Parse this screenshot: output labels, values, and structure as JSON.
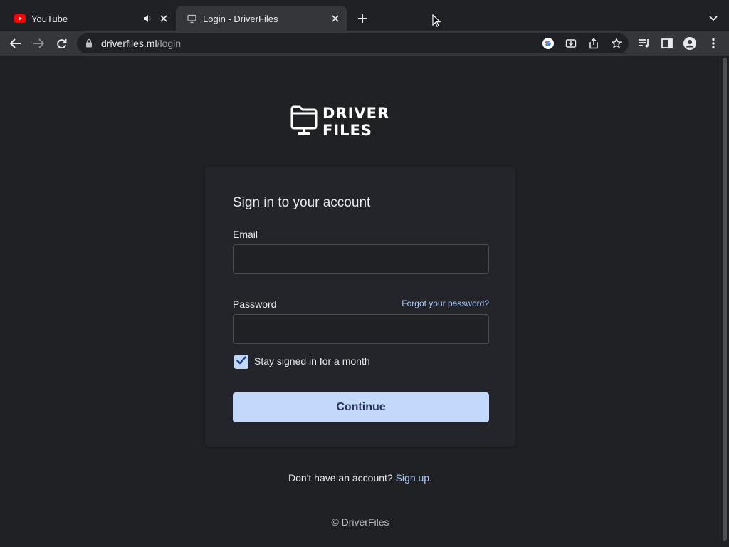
{
  "tabs": [
    {
      "title": "YouTube",
      "favicon": "youtube-icon",
      "audio": "speaker-icon"
    },
    {
      "title": "Login - DriverFiles",
      "favicon": "monitor-icon"
    }
  ],
  "address": {
    "host": "driverfiles.ml",
    "path": "/login"
  },
  "brand": {
    "name": "DRIVER FILES"
  },
  "login": {
    "heading": "Sign in to your account",
    "email_label": "Email",
    "email_value": "",
    "password_label": "Password",
    "password_value": "",
    "forgot_link": "Forgot your password?",
    "stay_signed_in_label": "Stay signed in for a month",
    "stay_signed_in_checked": true,
    "continue_label": "Continue"
  },
  "signup": {
    "prompt": "Don't have an account?",
    "link": "Sign up."
  },
  "footer": {
    "copyright": "© DriverFiles"
  },
  "colors": {
    "page_bg": "#202124",
    "card_bg": "#24252a",
    "button_bg": "#c2d9fb",
    "link": "#a8c7fa"
  }
}
